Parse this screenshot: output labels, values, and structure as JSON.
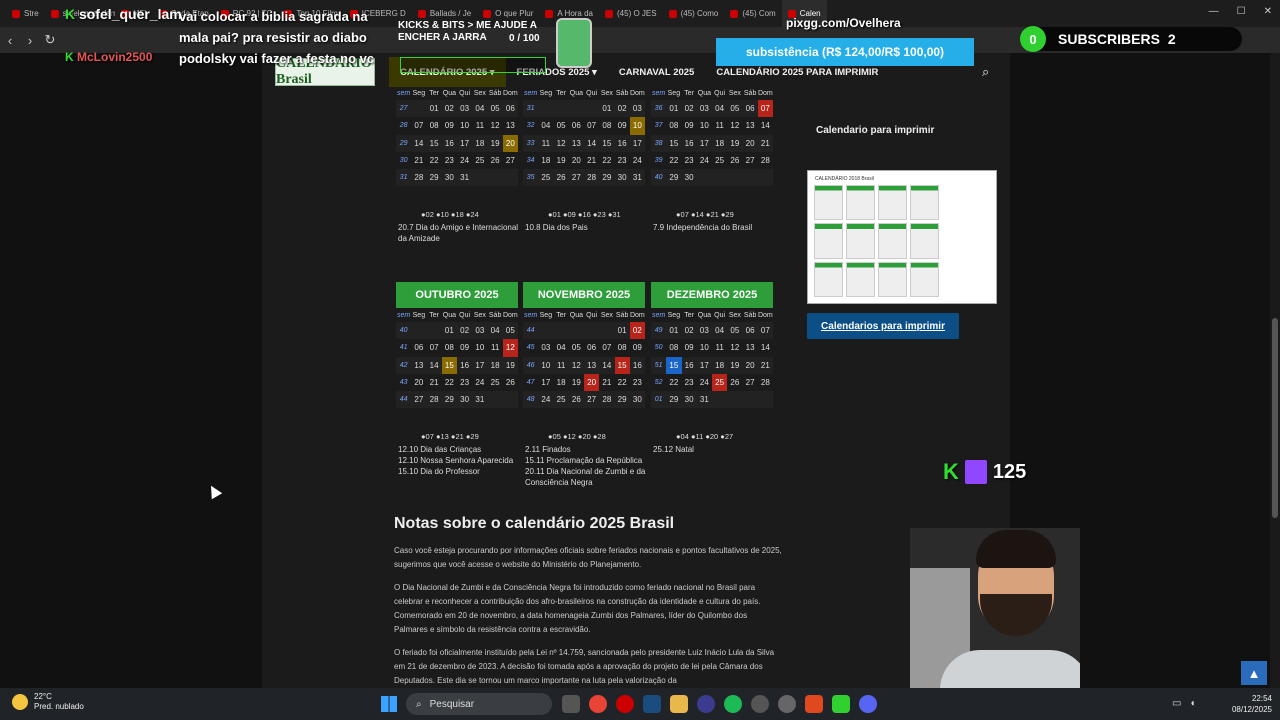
{
  "tabs": [
    "Stre",
    "sofel_quer_lam...",
    "(45)",
    "Cada Etap",
    "RC 92 | TC",
    "Top 10 Film",
    "ICEBERG D",
    "Ballads / Je",
    "O que Plur",
    "A Hora da",
    "(45) O JES",
    "(45) Como",
    "(45) Com",
    "Calen"
  ],
  "site": {
    "logo": "CALENDÁRIO Brasil",
    "menu": [
      "CALENDÁRIO 2025",
      "FERIADOS 2025",
      "CARNAVAL 2025",
      "CALENDÁRIO 2025 PARA IMPRIMIR"
    ],
    "weekday_headers": [
      "sem",
      "Seg",
      "Ter",
      "Qua",
      "Qui",
      "Sex",
      "Sáb",
      "Dom"
    ]
  },
  "months_top": [
    {
      "weeks": [
        [
          "27",
          "",
          "01",
          "02",
          "03",
          "04",
          "05",
          "06"
        ],
        [
          "28",
          "07",
          "08",
          "09",
          "10",
          "11",
          "12",
          "13"
        ],
        [
          "29",
          "14",
          "15",
          "16",
          "17",
          "18",
          "19",
          "20"
        ],
        [
          "30",
          "21",
          "22",
          "23",
          "24",
          "25",
          "26",
          "27"
        ],
        [
          "31",
          "28",
          "29",
          "30",
          "31",
          "",
          "",
          ""
        ]
      ],
      "moons": "●02 ●10 ●18 ●24",
      "holidays": [
        "20.7 Dia do Amigo e Internacional da Amizade"
      ]
    },
    {
      "weeks": [
        [
          "31",
          "",
          "",
          "",
          "",
          "01",
          "02",
          "03"
        ],
        [
          "32",
          "04",
          "05",
          "06",
          "07",
          "08",
          "09",
          "10"
        ],
        [
          "33",
          "11",
          "12",
          "13",
          "14",
          "15",
          "16",
          "17"
        ],
        [
          "34",
          "18",
          "19",
          "20",
          "21",
          "22",
          "23",
          "24"
        ],
        [
          "35",
          "25",
          "26",
          "27",
          "28",
          "29",
          "30",
          "31"
        ]
      ],
      "moons": "●01 ●09 ●16 ●23 ●31",
      "holidays": [
        "10.8 Dia dos Pais"
      ]
    },
    {
      "weeks": [
        [
          "36",
          "01",
          "02",
          "03",
          "04",
          "05",
          "06",
          "07"
        ],
        [
          "37",
          "08",
          "09",
          "10",
          "11",
          "12",
          "13",
          "14"
        ],
        [
          "38",
          "15",
          "16",
          "17",
          "18",
          "19",
          "20",
          "21"
        ],
        [
          "39",
          "22",
          "23",
          "24",
          "25",
          "26",
          "27",
          "28"
        ],
        [
          "40",
          "29",
          "30",
          "",
          "",
          "",
          "",
          ""
        ]
      ],
      "moons": "●07 ●14 ●21 ●29",
      "holidays": [
        "7.9 Independência do Brasil"
      ]
    }
  ],
  "months_bottom": [
    {
      "title": "OUTUBRO 2025",
      "weeks": [
        [
          "40",
          "",
          "",
          "01",
          "02",
          "03",
          "04",
          "05"
        ],
        [
          "41",
          "06",
          "07",
          "08",
          "09",
          "10",
          "11",
          "12"
        ],
        [
          "42",
          "13",
          "14",
          "15",
          "16",
          "17",
          "18",
          "19"
        ],
        [
          "43",
          "20",
          "21",
          "22",
          "23",
          "24",
          "25",
          "26"
        ],
        [
          "44",
          "27",
          "28",
          "29",
          "30",
          "31",
          "",
          ""
        ]
      ],
      "moons": "●07 ●13 ●21 ●29",
      "holidays": [
        "12.10 Dia das Crianças",
        "12.10 Nossa Senhora Aparecida",
        "15.10 Dia do Professor"
      ]
    },
    {
      "title": "NOVEMBRO 2025",
      "weeks": [
        [
          "44",
          "",
          "",
          "",
          "",
          "",
          "01",
          "02"
        ],
        [
          "45",
          "03",
          "04",
          "05",
          "06",
          "07",
          "08",
          "09"
        ],
        [
          "46",
          "10",
          "11",
          "12",
          "13",
          "14",
          "15",
          "16"
        ],
        [
          "47",
          "17",
          "18",
          "19",
          "20",
          "21",
          "22",
          "23"
        ],
        [
          "48",
          "24",
          "25",
          "26",
          "27",
          "28",
          "29",
          "30"
        ]
      ],
      "moons": "●05 ●12 ●20 ●28",
      "holidays": [
        "2.11 Finados",
        "15.11 Proclamação da República",
        "20.11 Dia Nacional de Zumbi e da Consciência Negra"
      ]
    },
    {
      "title": "DEZEMBRO 2025",
      "weeks": [
        [
          "49",
          "01",
          "02",
          "03",
          "04",
          "05",
          "06",
          "07"
        ],
        [
          "50",
          "08",
          "09",
          "10",
          "11",
          "12",
          "13",
          "14"
        ],
        [
          "51",
          "15",
          "16",
          "17",
          "18",
          "19",
          "20",
          "21"
        ],
        [
          "52",
          "22",
          "23",
          "24",
          "25",
          "26",
          "27",
          "28"
        ],
        [
          "01",
          "29",
          "30",
          "31",
          "",
          "",
          "",
          ""
        ]
      ],
      "moons": "●04 ●11 ●20 ●27",
      "holidays": [
        "25.12 Natal"
      ]
    }
  ],
  "notes": {
    "title": "Notas sobre o calendário 2025 Brasil",
    "p1": "Caso você esteja procurando por informações oficiais sobre feriados nacionais e pontos facultativos de 2025, sugerimos que você acesse o website do Ministério do Planejamento.",
    "p2": "O Dia Nacional de Zumbi e da Consciência Negra foi introduzido como feriado nacional no Brasil para celebrar e reconhecer a contribuição dos afro-brasileiros na construção da identidade e cultura do país. Comemorado em 20 de novembro, a data homenageia Zumbi dos Palmares, líder do Quilombo dos Palmares e símbolo da resistência contra a escravidão.",
    "p3": "O feriado foi oficialmente instituído pela Lei nº 14.759, sancionada pelo presidente Luiz Inácio Lula da Silva em 21 de dezembro de 2023. A decisão foi tomada após a aprovação do projeto de lei pela Câmara dos Deputados. Este dia se tornou um marco importante na luta pela valorização da"
  },
  "sidebar": {
    "title": "Calendario para imprimir",
    "thumb_title": "CALENDÁRIO 2018 Brasil",
    "button": "Calendarios para imprimir"
  },
  "overlay": {
    "chat1_user": "sofel_quer_lam...",
    "chat1_msg": "vai colocar a biblia sagrada na mala pai? pra resistir ao diabo podolsky vai fazer a festa no vc",
    "chat2_user": "McLovin2500",
    "goal": "KICKS & BITS > ME AJUDE A ENCHER A JARRA",
    "goal_count": "0  / 100",
    "pix": "pixgg.com/Ovelhera",
    "sub_goal": "subsistência (R$ 124,00/R$ 100,00)",
    "subs_count": "0",
    "subs_label": "SUBSCRIBERS",
    "subs_num": "2",
    "viewers": "125"
  },
  "taskbar": {
    "temp": "22°C",
    "weather": "Pred. nublado",
    "search": "Pesquisar",
    "time": "22:54",
    "date": "08/12/2025"
  }
}
